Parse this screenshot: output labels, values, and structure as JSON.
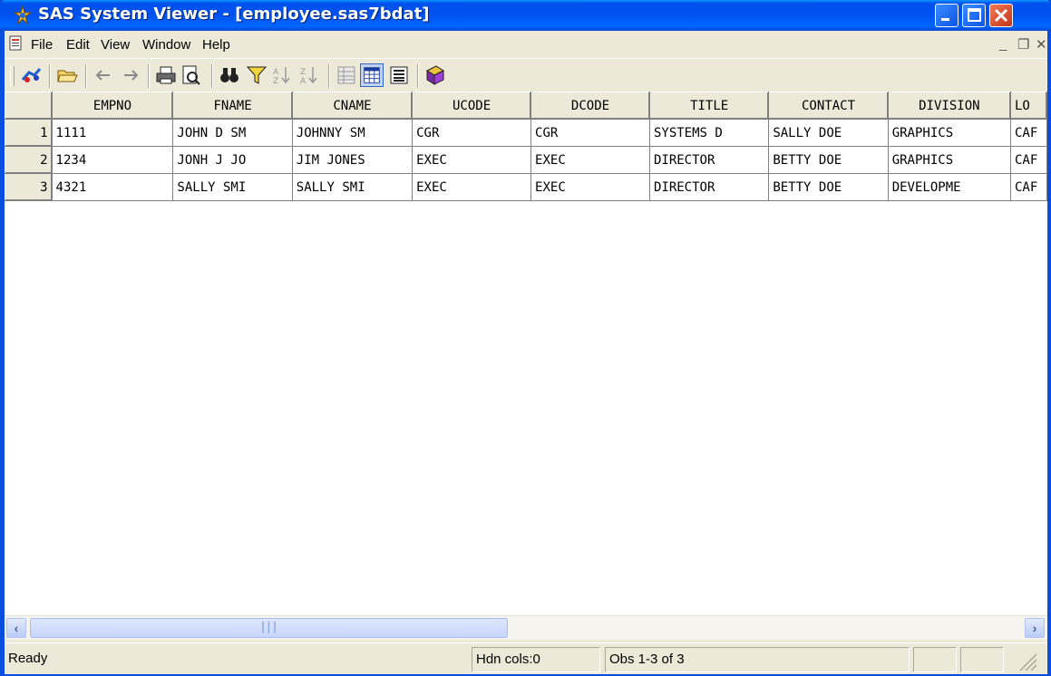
{
  "window": {
    "title": "SAS System Viewer - [employee.sas7bdat]"
  },
  "menubar": {
    "items": [
      "File",
      "Edit",
      "View",
      "Window",
      "Help"
    ]
  },
  "toolbar": {
    "buttons": [
      "open-data-icon",
      "open-folder-icon",
      "back-arrow-icon",
      "forward-arrow-icon",
      "print-icon",
      "print-preview-icon",
      "find-icon",
      "filter-icon",
      "sort-ascending-icon",
      "sort-descending-icon",
      "column-view-icon",
      "table-view-icon",
      "form-view-icon",
      "help-book-icon"
    ]
  },
  "grid": {
    "columns": [
      "EMPNO",
      "FNAME",
      "CNAME",
      "UCODE",
      "DCODE",
      "TITLE",
      "CONTACT",
      "DIVISION",
      "LO"
    ],
    "rows": [
      {
        "num": "1",
        "cells": [
          "1111",
          "JOHN D SM",
          "JOHNNY SM",
          "CGR",
          "CGR",
          "SYSTEMS D",
          "SALLY DOE",
          "GRAPHICS",
          "CAF"
        ]
      },
      {
        "num": "2",
        "cells": [
          "1234",
          "JONH J JO",
          "JIM JONES",
          "EXEC",
          "EXEC",
          "DIRECTOR",
          "BETTY DOE",
          "GRAPHICS",
          "CAF"
        ]
      },
      {
        "num": "3",
        "cells": [
          "4321",
          "SALLY SMI",
          "SALLY SMI",
          "EXEC",
          "EXEC",
          "DIRECTOR",
          "BETTY DOE",
          "DEVELOPME",
          "CAF"
        ]
      }
    ]
  },
  "statusbar": {
    "status": "Ready",
    "hidden_cols": "Hdn cols:0",
    "obs": "Obs 1-3 of 3"
  },
  "colors": {
    "titlebar": "#0053ee",
    "chrome": "#ece9d8",
    "selected_tool": "#c1d2ee"
  }
}
